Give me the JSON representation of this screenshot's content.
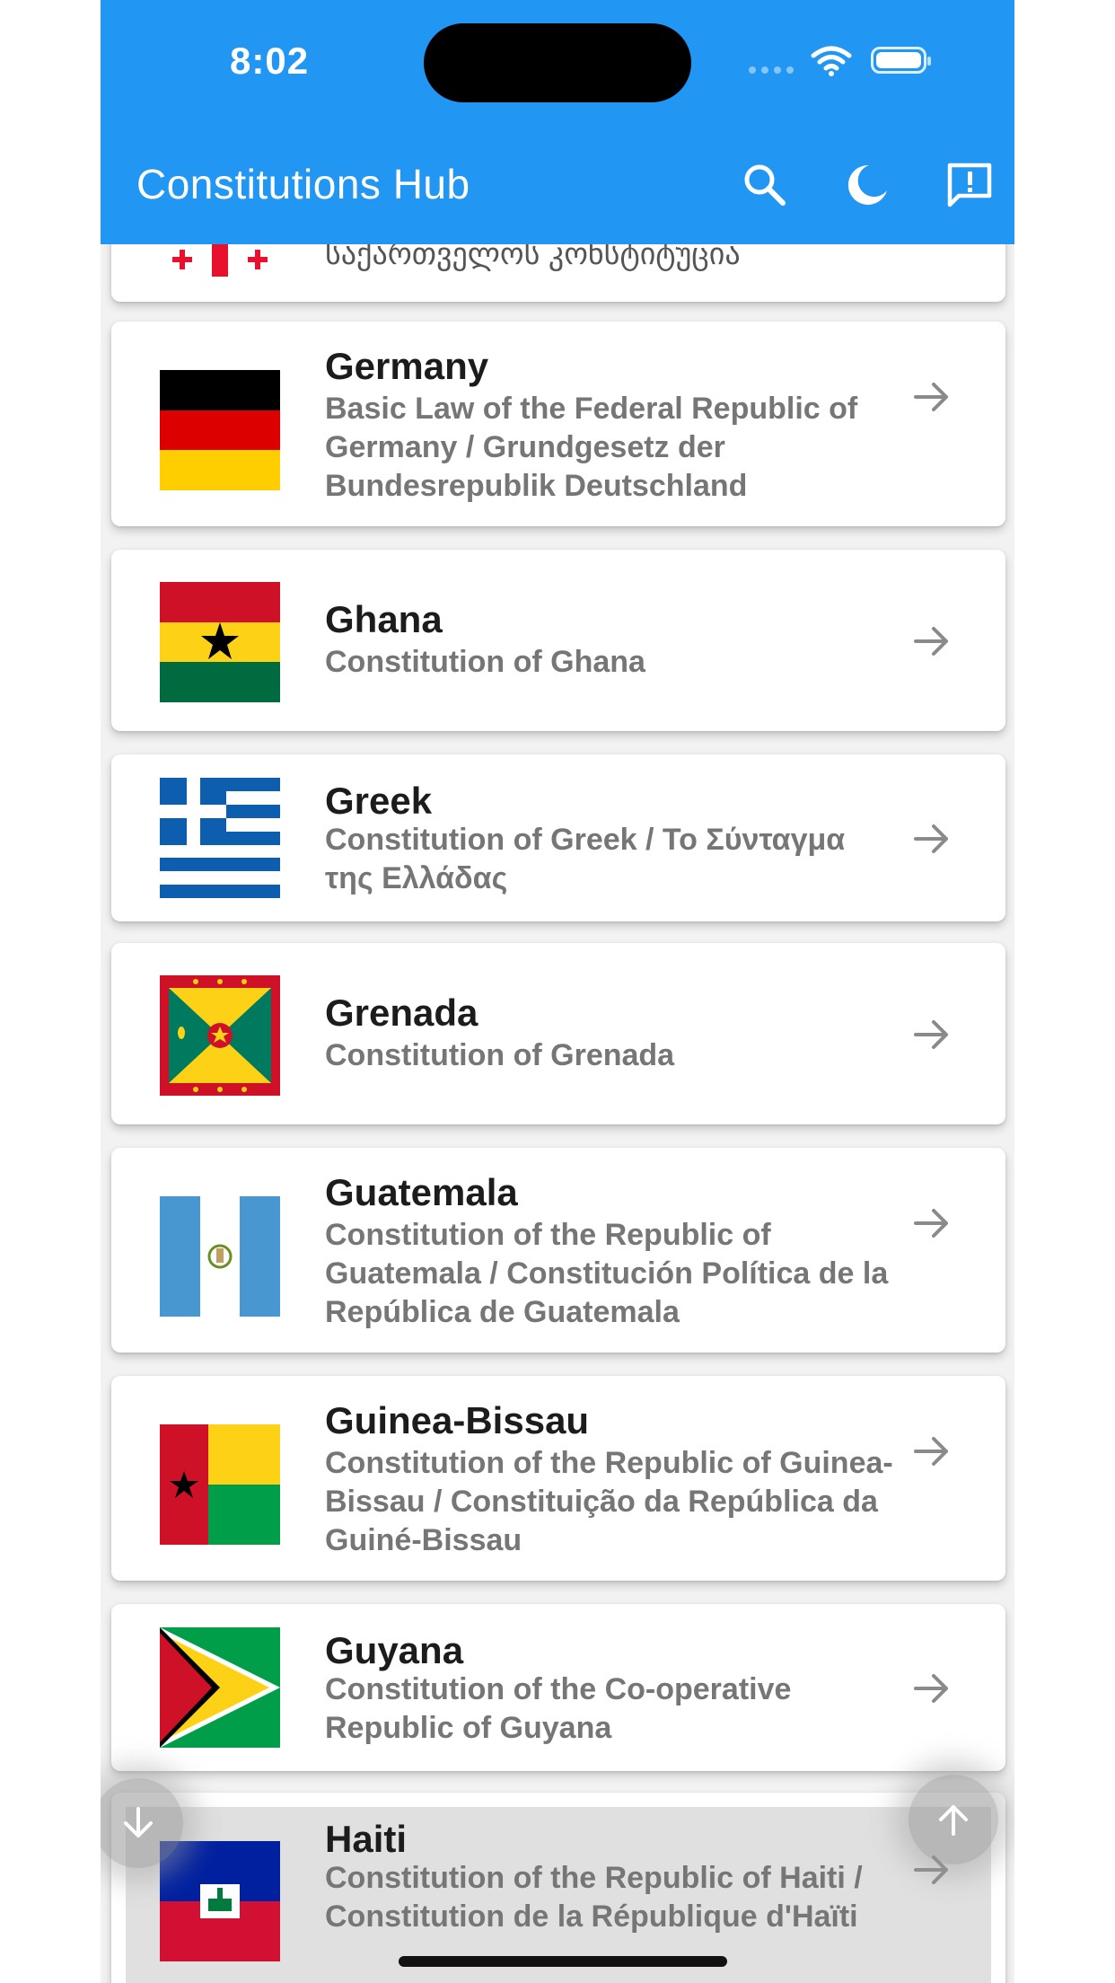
{
  "status_bar": {
    "time": "8:02"
  },
  "app_bar": {
    "title": "Constitutions Hub",
    "actions": [
      "search-icon",
      "dark-mode-icon",
      "feedback-icon"
    ]
  },
  "colors": {
    "app_bar": "#2196f3",
    "card": "#ffffff",
    "highlight": "#e0e0e0",
    "subtitle": "#767676"
  },
  "list": {
    "partial_top": {
      "desc": "საქართველოს კონსტიტუცია"
    },
    "items": [
      {
        "name": "Germany",
        "desc": "Basic Law of the Federal Republic of Germany / Grundgesetz der Bundesrepublik Deutschland"
      },
      {
        "name": "Ghana",
        "desc": "Constitution of Ghana"
      },
      {
        "name": "Greek",
        "desc": "Constitution of Greek / Το Σύνταγμα της Ελλάδας"
      },
      {
        "name": "Grenada",
        "desc": "Constitution of Grenada"
      },
      {
        "name": "Guatemala",
        "desc": "Constitution of the Republic of Guatemala / Constitución Política de la República de Guatemala"
      },
      {
        "name": "Guinea-Bissau",
        "desc": "Constitution of the Republic of Guinea-Bissau / Constituição da República da Guiné-Bissau"
      },
      {
        "name": "Guyana",
        "desc": "Constitution of the Co-operative Republic of Guyana"
      },
      {
        "name": "Haiti",
        "desc": "Constitution of the Republic of Haiti / Constitution de la République d'Haïti"
      }
    ]
  },
  "fabs": {
    "down": "arrow-down-icon",
    "up": "arrow-up-icon"
  }
}
